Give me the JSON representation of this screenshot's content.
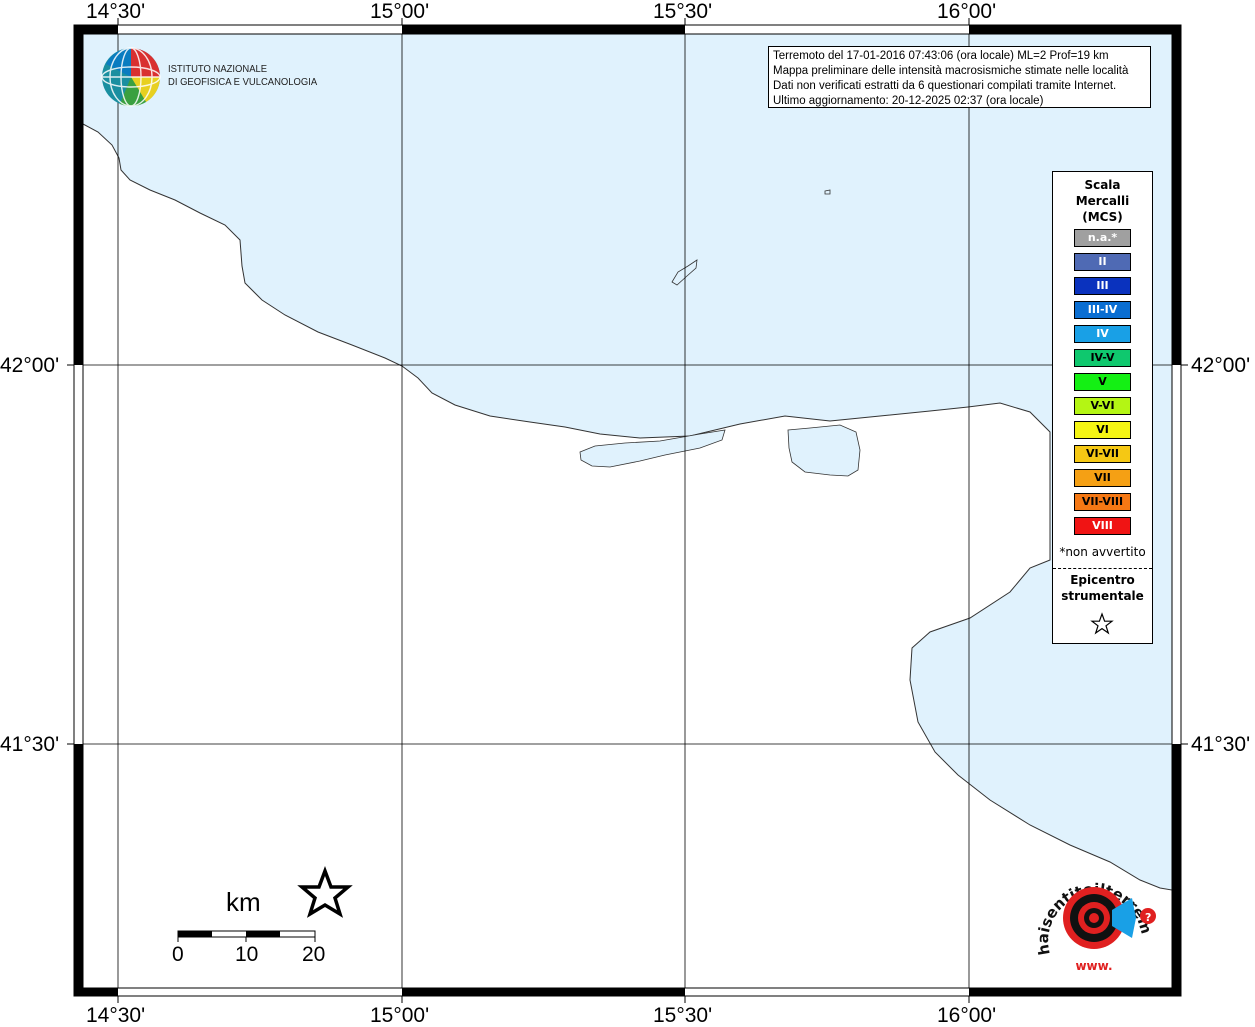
{
  "map": {
    "lon_labels": [
      "14°30'",
      "15°00'",
      "15°30'",
      "16°00'"
    ],
    "lat_labels": [
      "42°00'",
      "41°30'"
    ],
    "colors": {
      "sea": "#e0f2fd",
      "land": "#ffffff",
      "coastline": "#333333",
      "grid": "#000000"
    }
  },
  "info": {
    "line1": "Terremoto del 17-01-2016 07:43:06 (ora locale) ML=2 Prof=19 km",
    "line2": "Mappa preliminare delle intensità macrosismiche stimate nelle località",
    "line3": "Dati non verificati estratti da 6 questionari compilati tramite Internet.",
    "line4": "Ultimo aggiornamento: 20-12-2025 02:37 (ora locale)"
  },
  "logo": {
    "line1": "ISTITUTO NAZIONALE",
    "line2": "DI GEOFISICA E VULCANOLOGIA"
  },
  "legend": {
    "title_1": "Scala",
    "title_2": "Mercalli",
    "title_3": "(MCS)",
    "items": [
      {
        "label": "n.a.*",
        "color": "#a0a0a0",
        "text_color": "#ffffff"
      },
      {
        "label": "II",
        "color": "#4f6ab4",
        "text_color": "#ffffff"
      },
      {
        "label": "III",
        "color": "#0a32be",
        "text_color": "#ffffff"
      },
      {
        "label": "III-IV",
        "color": "#0a6ed2",
        "text_color": "#ffffff"
      },
      {
        "label": "IV",
        "color": "#19a0e6",
        "text_color": "#ffffff"
      },
      {
        "label": "IV-V",
        "color": "#0fc86e",
        "text_color": "#000000"
      },
      {
        "label": "V",
        "color": "#14f014",
        "text_color": "#000000"
      },
      {
        "label": "V-VI",
        "color": "#b4f514",
        "text_color": "#000000"
      },
      {
        "label": "VI",
        "color": "#f5f514",
        "text_color": "#000000"
      },
      {
        "label": "VI-VII",
        "color": "#f5c814",
        "text_color": "#000000"
      },
      {
        "label": "VII",
        "color": "#f5a014",
        "text_color": "#000000"
      },
      {
        "label": "VII-VIII",
        "color": "#f57814",
        "text_color": "#000000"
      },
      {
        "label": "VIII",
        "color": "#f01414",
        "text_color": "#ffffff"
      }
    ],
    "note": "*non avvertito",
    "epicenter_1": "Epicentro",
    "epicenter_2": "strumentale",
    "epicenter_icon": "star-outline-icon"
  },
  "scalebar": {
    "unit": "km",
    "ticks": [
      "0",
      "10",
      "20"
    ]
  },
  "watermark": {
    "text": "haisentitoilterremoto.it",
    "prefix": "www.",
    "icon": "target-megaphone-icon"
  },
  "epicenter": {
    "marker_icon": "star-outline-icon"
  }
}
